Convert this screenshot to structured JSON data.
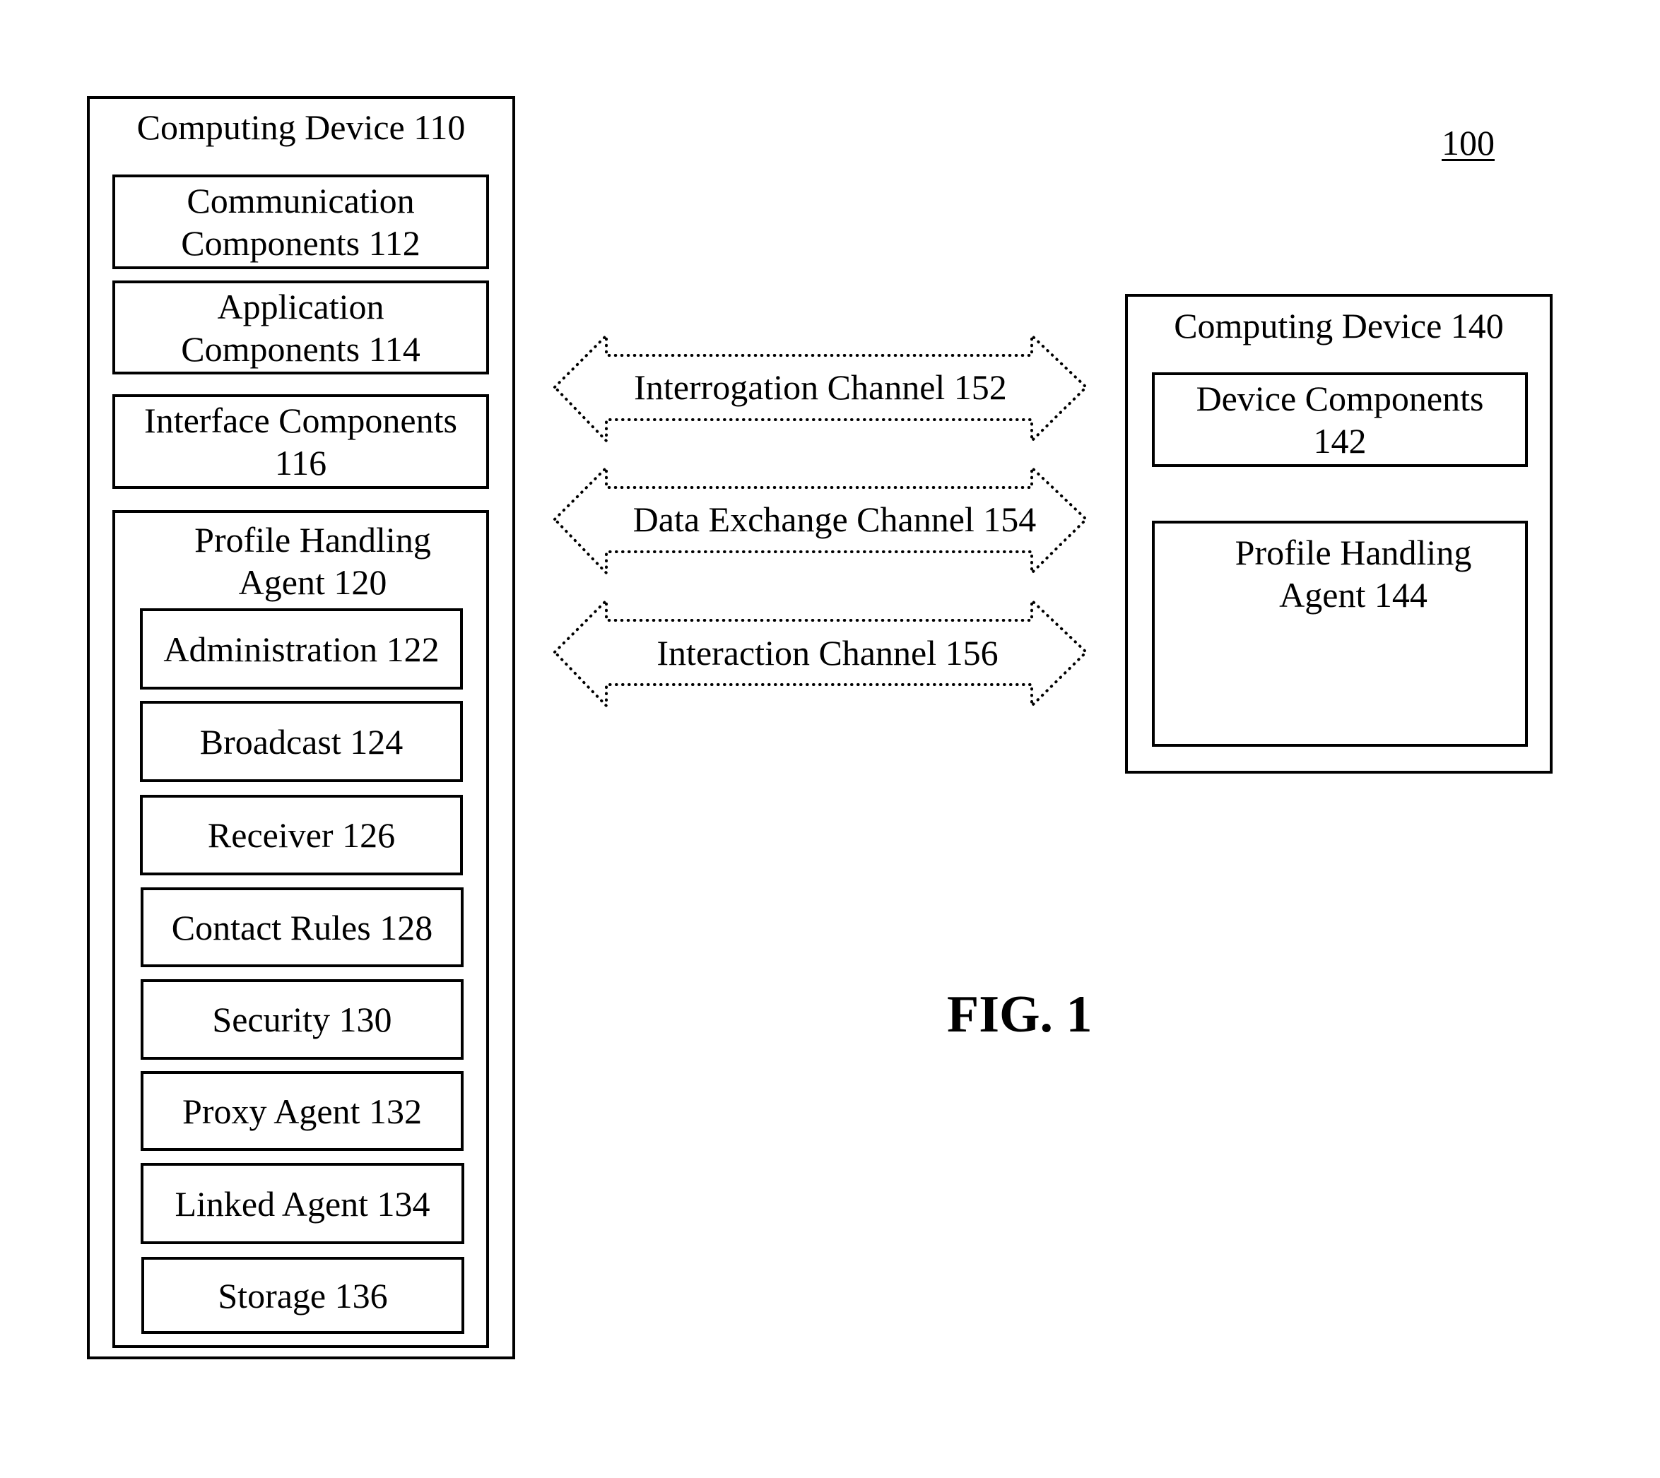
{
  "figure": {
    "reference_numeral": "100",
    "caption": "FIG. 1"
  },
  "device_110": {
    "title": "Computing Device 110",
    "components": [
      {
        "lines": [
          "Communication",
          "Components 112"
        ]
      },
      {
        "lines": [
          "Application",
          "Components 114"
        ]
      },
      {
        "lines": [
          "Interface Components",
          "116"
        ]
      }
    ],
    "agent": {
      "title_lines": [
        "Profile Handling",
        "Agent 120"
      ],
      "modules": [
        "Administration 122",
        "Broadcast 124",
        "Receiver 126",
        "Contact Rules 128",
        "Security 130",
        "Proxy Agent 132",
        "Linked Agent 134",
        "Storage 136"
      ]
    }
  },
  "device_140": {
    "title": "Computing Device 140",
    "components": {
      "lines": [
        "Device Components",
        "142"
      ]
    },
    "agent": {
      "title_lines": [
        "Profile Handling",
        "Agent 144"
      ]
    }
  },
  "channels": [
    {
      "label": "Interrogation Channel 152",
      "direction": "bidirectional",
      "style": "dotted"
    },
    {
      "label": "Data Exchange Channel 154",
      "direction": "bidirectional",
      "style": "dotted"
    },
    {
      "label": "Interaction Channel 156",
      "direction": "bidirectional",
      "style": "dotted"
    }
  ]
}
